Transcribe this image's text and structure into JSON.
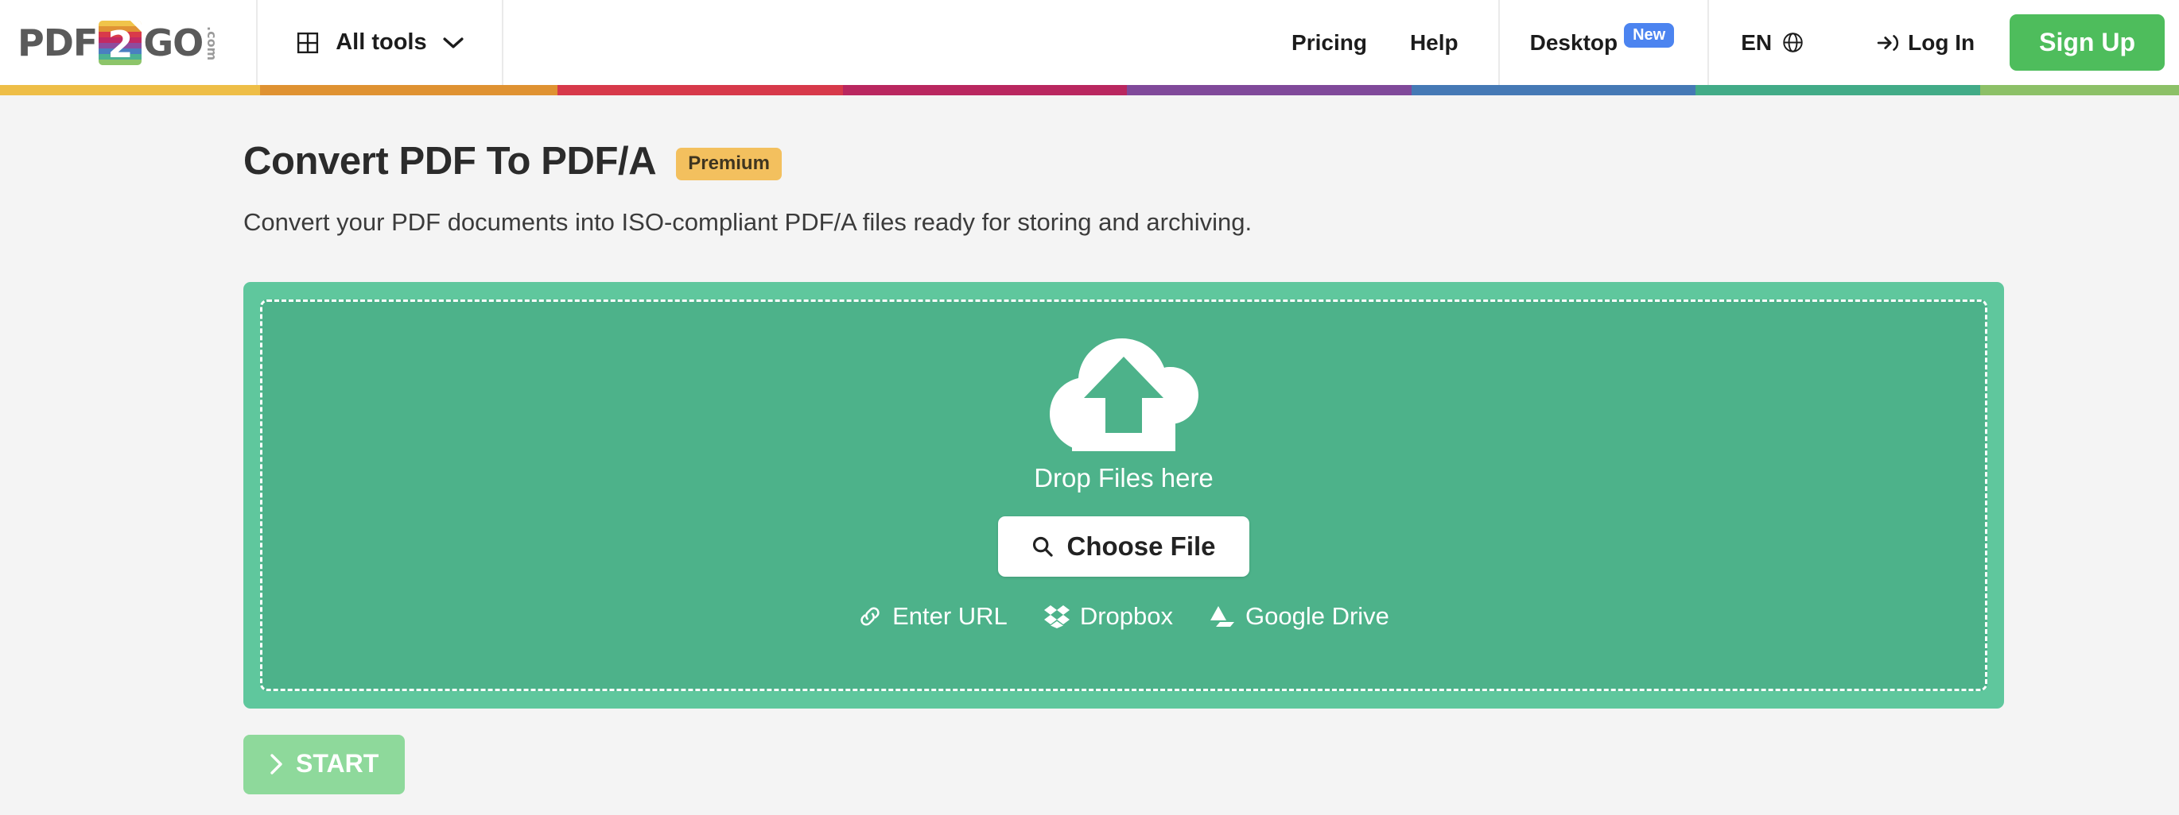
{
  "header": {
    "logo": {
      "text_left": "PDF",
      "block_char": "2",
      "text_right": "GO",
      "dotcom": ".com",
      "stripe_colors": [
        "#f0c44a",
        "#e09335",
        "#d93a4a",
        "#c22a63",
        "#8e4c9e",
        "#4a7fc1",
        "#4cb292",
        "#8dc56a"
      ]
    },
    "all_tools": {
      "label": "All tools",
      "grid_icon": "grid-icon",
      "chevron_icon": "chevron-down-icon"
    },
    "nav": [
      {
        "label": "Pricing",
        "name": "nav-pricing"
      },
      {
        "label": "Help",
        "name": "nav-help"
      }
    ],
    "desktop": {
      "label": "Desktop",
      "badge": "New",
      "badge_color": "#4c84f0"
    },
    "language": {
      "label": "EN",
      "icon": "globe-icon"
    },
    "login": {
      "label": "Log In",
      "icon": "login-arrow-icon"
    },
    "signup": {
      "label": "Sign Up",
      "color": "#4ebd5c"
    }
  },
  "stripe_bar": {
    "colors": [
      "#eebe47",
      "#df9232",
      "#d7394a",
      "#b9275f",
      "#80499a",
      "#4579b5",
      "#42ab87",
      "#8cc067"
    ],
    "widths": [
      327,
      374,
      359,
      357,
      358,
      357,
      358,
      250
    ]
  },
  "main": {
    "title": "Convert PDF To PDF/A",
    "premium_badge": "Premium",
    "premium_color": "#f3c05e",
    "subtitle": "Convert your PDF documents into ISO-compliant PDF/A files ready for storing and archiving."
  },
  "dropzone": {
    "cloud_icon": "cloud-upload-icon",
    "drop_text": "Drop Files here",
    "choose_file": {
      "label": "Choose File",
      "icon": "search-icon"
    },
    "sources": [
      {
        "label": "Enter URL",
        "icon": "link-icon",
        "name": "source-enter-url"
      },
      {
        "label": "Dropbox",
        "icon": "dropbox-icon",
        "name": "source-dropbox"
      },
      {
        "label": "Google Drive",
        "icon": "google-drive-icon",
        "name": "source-google-drive"
      }
    ],
    "outer_color": "#5fc79d",
    "inner_color": "#4db28a"
  },
  "start": {
    "label": "START",
    "icon": "chevron-right-icon",
    "color": "#8ed99b"
  }
}
